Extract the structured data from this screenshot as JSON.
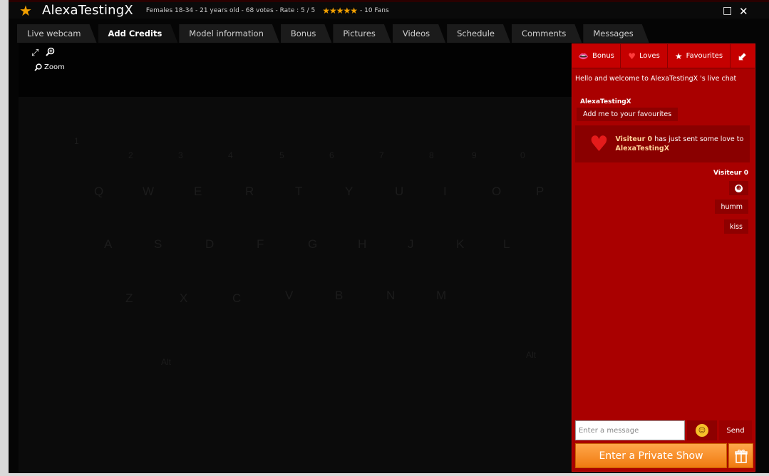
{
  "title_bar": {
    "star_icon": "star-icon",
    "model_name": "AlexaTestingX",
    "stats": "Females 18-34 - 21 years old - 68 votes - Rate : 5 / 5",
    "rating_stars": "★★★★★",
    "fans": "- 10 Fans",
    "restore_icon": "□",
    "close_icon": "✕"
  },
  "tabs": [
    {
      "label": "Live webcam",
      "active": false
    },
    {
      "label": "Add Credits",
      "active": true
    },
    {
      "label": "Model information",
      "active": false
    },
    {
      "label": "Bonus",
      "active": false
    },
    {
      "label": "Pictures",
      "active": false
    },
    {
      "label": "Videos",
      "active": false
    },
    {
      "label": "Schedule",
      "active": false
    },
    {
      "label": "Comments",
      "active": false
    },
    {
      "label": "Messages",
      "active": false
    }
  ],
  "video": {
    "zoom_label": "Zoom"
  },
  "chat": {
    "tabs": [
      {
        "label": "Bonus",
        "icon": "lips-icon"
      },
      {
        "label": "Loves",
        "icon": "heart-icon"
      },
      {
        "label": "Favourites",
        "icon": "star-icon"
      }
    ],
    "welcome": "Hello and welcome to AlexaTestingX 's live chat",
    "model_sender": "AlexaTestingX",
    "model_message": "Add me to your favourites",
    "love_notice": {
      "user": "Visiteur 0",
      "text": "has just sent some love to",
      "target": "AlexaTestingX"
    },
    "visitor_sender": "Visiteur 0",
    "visitor_messages": [
      "humm",
      "kiss"
    ],
    "input_placeholder": "Enter a message",
    "send_label": "Send",
    "private_show_label": "Enter a Private Show"
  },
  "colors": {
    "accent_orange": "#f07a10",
    "chat_red": "#a90000",
    "star_gold": "#f3a000"
  }
}
